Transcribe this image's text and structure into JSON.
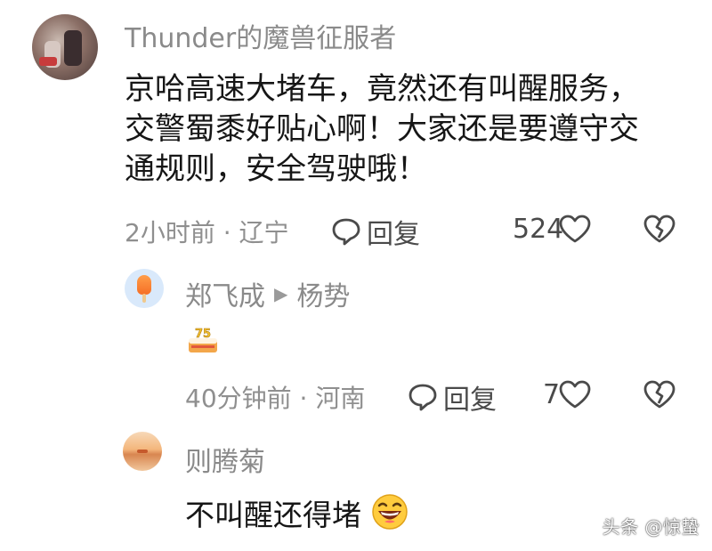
{
  "comment": {
    "username": "Thunder的魔兽征服者",
    "text_line1": "京哈高速大堵车，竟然还有叫醒服务，",
    "text_line2": "交警蜀黍好贴心啊！大家还是要遵守交",
    "text_line3": "通规则，安全驾驶哦！",
    "meta": "2小时前 · 辽宁",
    "reply_label": "回复",
    "like_count": "524"
  },
  "replies": [
    {
      "username": "郑飞成",
      "arrow": "▶",
      "reply_to": "杨势",
      "content_icon": "cake-icon",
      "meta": "40分钟前 · 河南",
      "reply_label": "回复",
      "like_count": "7"
    },
    {
      "username": "则腾菊",
      "text": "不叫醒还得堵",
      "content_icon": "grinning-face-icon"
    }
  ],
  "watermark": "头条 @惊蛰",
  "colors": {
    "text": "#161616",
    "muted": "#8f8f8f",
    "icon": "#4a4a4a"
  }
}
